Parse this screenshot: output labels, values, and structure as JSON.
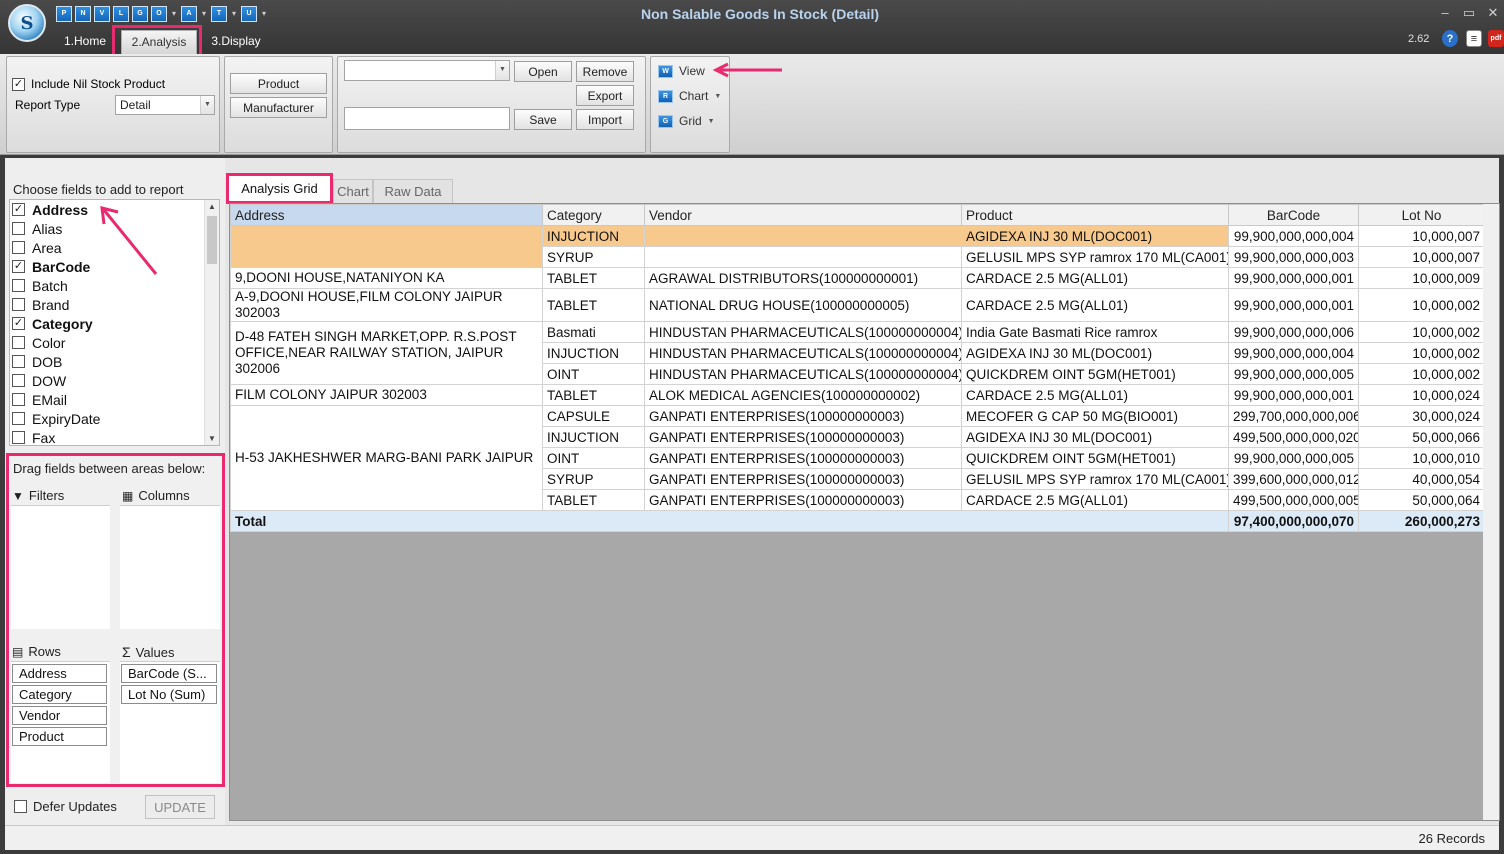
{
  "window": {
    "title": "Non Salable Goods In Stock (Detail)",
    "version": "2.62",
    "logo_text": "S",
    "controls": {
      "minimize": "–",
      "restore": "▭",
      "close": "✕"
    },
    "quick_access": [
      "P",
      "N",
      "V",
      "L",
      "G",
      "O",
      "A",
      "T",
      "U"
    ]
  },
  "ribbon_tabs": [
    {
      "label": "1.Home"
    },
    {
      "label": "2.Analysis"
    },
    {
      "label": "3.Display"
    }
  ],
  "ribbon": {
    "include_nil_label": "Include Nil Stock Product",
    "include_nil_checked": true,
    "report_type_label": "Report Type",
    "report_type_value": "Detail",
    "product_button": "Product",
    "manufacturer_button": "Manufacturer",
    "layout_combo_value": "",
    "layout_name_value": "",
    "open_button": "Open",
    "remove_button": "Remove",
    "export_button": "Export",
    "save_button": "Save",
    "import_button": "Import",
    "view_button": "View",
    "chart_button": "Chart",
    "grid_button": "Grid"
  },
  "field_chooser": {
    "label": "Choose fields to add to report",
    "fields": [
      {
        "label": "Address",
        "checked": true
      },
      {
        "label": "Alias",
        "checked": false
      },
      {
        "label": "Area",
        "checked": false
      },
      {
        "label": "BarCode",
        "checked": true
      },
      {
        "label": "Batch",
        "checked": false
      },
      {
        "label": "Brand",
        "checked": false
      },
      {
        "label": "Category",
        "checked": true
      },
      {
        "label": "Color",
        "checked": false
      },
      {
        "label": "DOB",
        "checked": false
      },
      {
        "label": "DOW",
        "checked": false
      },
      {
        "label": "EMail",
        "checked": false
      },
      {
        "label": "ExpiryDate",
        "checked": false
      },
      {
        "label": "Fax",
        "checked": false
      }
    ]
  },
  "areas": {
    "label": "Drag fields between areas below:",
    "filters": {
      "label": "Filters",
      "items": []
    },
    "columns": {
      "label": "Columns",
      "items": []
    },
    "rows": {
      "label": "Rows",
      "items": [
        "Address",
        "Category",
        "Vendor",
        "Product"
      ]
    },
    "values": {
      "label": "Values",
      "items": [
        "BarCode (S...",
        "Lot No (Sum)"
      ]
    },
    "defer_label": "Defer Updates",
    "update_button": "UPDATE"
  },
  "grid_tabs": [
    {
      "label": "Analysis Grid"
    },
    {
      "label": "Chart"
    },
    {
      "label": "Raw Data"
    }
  ],
  "grid": {
    "columns": [
      "Address",
      "Category",
      "Vendor",
      "Product",
      "BarCode",
      "Lot No"
    ],
    "groups": [
      {
        "address": "",
        "rows": [
          [
            "INJUCTION",
            "",
            "AGIDEXA INJ 30 ML(DOC001)",
            "99,900,000,000,004",
            "10,000,007"
          ],
          [
            "SYRUP",
            "",
            "GELUSIL MPS SYP ramrox 170 ML(CA001)",
            "99,900,000,000,003",
            "10,000,007"
          ]
        ]
      },
      {
        "address": "9,DOONI HOUSE,NATANIYON KA",
        "rows": [
          [
            "TABLET",
            "AGRAWAL DISTRIBUTORS(100000000001)",
            "CARDACE 2.5 MG(ALL01)",
            "99,900,000,000,001",
            "10,000,009"
          ]
        ]
      },
      {
        "address": "A-9,DOONI HOUSE,FILM COLONY JAIPUR 302003",
        "rows": [
          [
            "TABLET",
            "NATIONAL DRUG HOUSE(100000000005)",
            "CARDACE 2.5 MG(ALL01)",
            "99,900,000,000,001",
            "10,000,002"
          ]
        ]
      },
      {
        "address": "D-48 FATEH SINGH MARKET,OPP. R.S.POST OFFICE,NEAR RAILWAY STATION, JAIPUR 302006",
        "rows": [
          [
            "Basmati",
            "HINDUSTAN PHARMACEUTICALS(100000000004)",
            "India Gate Basmati Rice ramrox",
            "99,900,000,000,006",
            "10,000,002"
          ],
          [
            "INJUCTION",
            "HINDUSTAN PHARMACEUTICALS(100000000004)",
            "AGIDEXA INJ 30 ML(DOC001)",
            "99,900,000,000,004",
            "10,000,002"
          ],
          [
            "OINT",
            "HINDUSTAN PHARMACEUTICALS(100000000004)",
            "QUICKDREM OINT 5GM(HET001)",
            "99,900,000,000,005",
            "10,000,002"
          ]
        ]
      },
      {
        "address": "FILM COLONY  JAIPUR 302003",
        "rows": [
          [
            "TABLET",
            "ALOK MEDICAL AGENCIES(100000000002)",
            "CARDACE 2.5 MG(ALL01)",
            "99,900,000,000,001",
            "10,000,024"
          ]
        ]
      },
      {
        "address": "H-53 JAKHESHWER MARG-BANI PARK JAIPUR",
        "rows": [
          [
            "CAPSULE",
            "GANPATI ENTERPRISES(100000000003)",
            "MECOFER G CAP 50 MG(BIO001)",
            "299,700,000,000,006",
            "30,000,024"
          ],
          [
            "INJUCTION",
            "GANPATI ENTERPRISES(100000000003)",
            "AGIDEXA INJ 30 ML(DOC001)",
            "499,500,000,000,020",
            "50,000,066"
          ],
          [
            "OINT",
            "GANPATI ENTERPRISES(100000000003)",
            "QUICKDREM OINT 5GM(HET001)",
            "99,900,000,000,005",
            "10,000,010"
          ],
          [
            "SYRUP",
            "GANPATI ENTERPRISES(100000000003)",
            "GELUSIL MPS SYP ramrox 170 ML(CA001)",
            "399,600,000,000,012",
            "40,000,054"
          ],
          [
            "TABLET",
            "GANPATI ENTERPRISES(100000000003)",
            "CARDACE 2.5 MG(ALL01)",
            "499,500,000,000,005",
            "50,000,064"
          ]
        ]
      }
    ],
    "total_label": "Total",
    "total_barcode": "97,400,000,000,070",
    "total_lot": "260,000,273"
  },
  "status": {
    "records": "26 Records"
  },
  "colors": {
    "annotation": "#ea2a6e",
    "selection": "#f8c98c",
    "accent": "#1566b8"
  }
}
